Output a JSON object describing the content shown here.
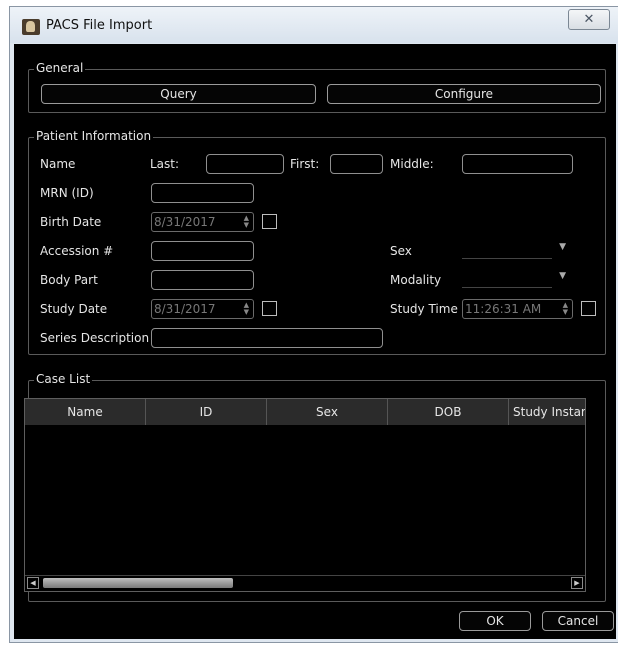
{
  "window": {
    "title": "PACS File Import",
    "close_glyph": "✕"
  },
  "general": {
    "title": "General",
    "query_label": "Query",
    "configure_label": "Configure"
  },
  "patient": {
    "title": "Patient Information",
    "name_label": "Name",
    "last_label": "Last:",
    "first_label": "First:",
    "middle_label": "Middle:",
    "mrn_label": "MRN (ID)",
    "birth_date_label": "Birth Date",
    "birth_date_value": "8/31/2017",
    "accession_label": "Accession #",
    "sex_label": "Sex",
    "body_part_label": "Body Part",
    "modality_label": "Modality",
    "study_date_label": "Study Date",
    "study_date_value": "8/31/2017",
    "study_time_label": "Study Time",
    "study_time_value": "11:26:31 AM",
    "series_desc_label": "Series Description"
  },
  "case_list": {
    "title": "Case List",
    "columns": [
      "Name",
      "ID",
      "Sex",
      "DOB",
      "Study Instar"
    ]
  },
  "footer": {
    "ok_label": "OK",
    "cancel_label": "Cancel"
  },
  "icons": {
    "window": "pacs-app-icon",
    "close": "close-icon",
    "spin": "spin-arrows-icon",
    "dropdown": "chevron-down-icon",
    "scroll_left": "scroll-left-icon",
    "scroll_right": "scroll-right-icon"
  }
}
